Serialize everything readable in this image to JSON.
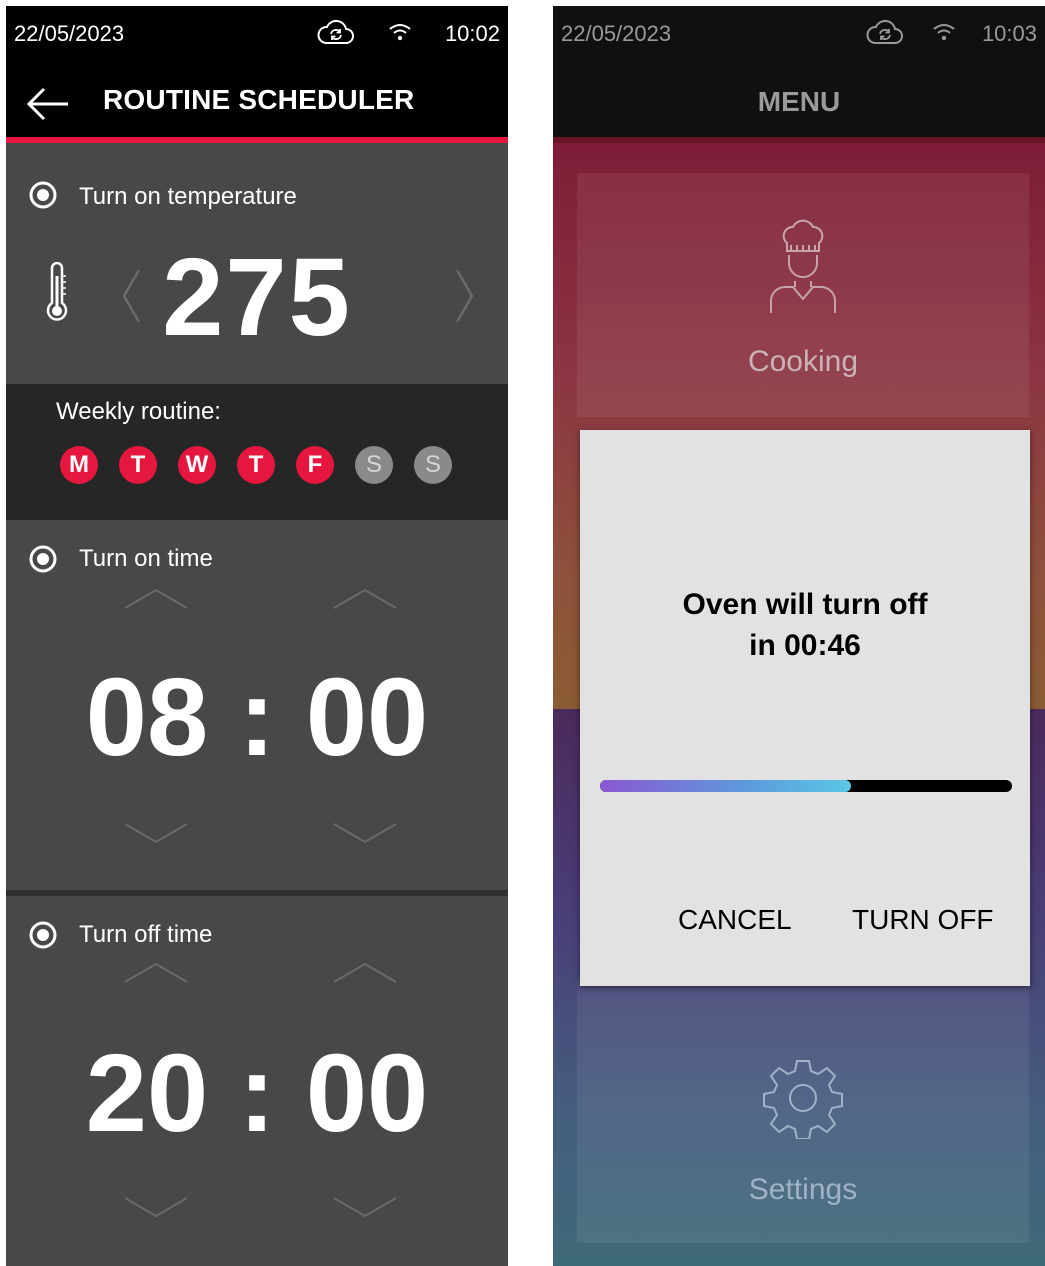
{
  "left_screen": {
    "status": {
      "date": "22/05/2023",
      "time": "10:02",
      "cloud_icon": "cloud-sync-icon",
      "wifi_icon": "wifi-icon"
    },
    "header": {
      "title": "ROUTINE SCHEDULER",
      "back_icon": "back-arrow-icon"
    },
    "temperature": {
      "label": "Turn on temperature",
      "value": "275",
      "icon": "thermometer-icon"
    },
    "weekly": {
      "label": "Weekly routine:",
      "days": [
        {
          "letter": "M",
          "active": true
        },
        {
          "letter": "T",
          "active": true
        },
        {
          "letter": "W",
          "active": true
        },
        {
          "letter": "T",
          "active": true
        },
        {
          "letter": "F",
          "active": true
        },
        {
          "letter": "S",
          "active": false
        },
        {
          "letter": "S",
          "active": false
        }
      ]
    },
    "turn_on_time": {
      "label": "Turn on time",
      "value": "08 : 00"
    },
    "turn_off_time": {
      "label": "Turn off time",
      "value": "20 : 00"
    }
  },
  "right_screen": {
    "status": {
      "date": "22/05/2023",
      "time": "10:03"
    },
    "header": {
      "title": "MENU"
    },
    "tiles": {
      "cooking": "Cooking",
      "settings": "Settings"
    },
    "dialog": {
      "message_line1": "Oven will turn off",
      "message_line2": "in 00:46",
      "progress": 0.61,
      "cancel_label": "CANCEL",
      "turn_off_label": "TURN OFF"
    }
  },
  "colors": {
    "accent": "#e5173f",
    "panel": "#484848",
    "weekly_bg": "#262626"
  }
}
